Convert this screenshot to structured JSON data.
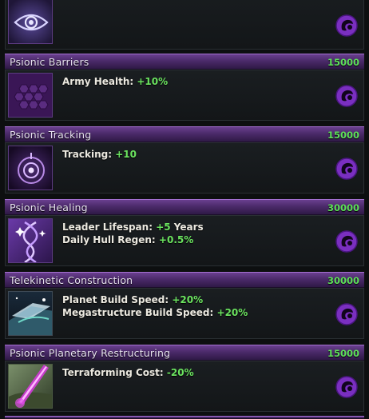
{
  "entries": [
    {
      "name": "",
      "cost": "",
      "icon": "eye-icon",
      "effects": []
    },
    {
      "name": "Psionic Barriers",
      "cost": "15000",
      "icon": "hex-shield-icon",
      "effects": [
        {
          "label": "Army Health:",
          "value": "+10%"
        }
      ]
    },
    {
      "name": "Psionic Tracking",
      "cost": "15000",
      "icon": "tracking-orb-icon",
      "effects": [
        {
          "label": "Tracking:",
          "value": "+10"
        }
      ]
    },
    {
      "name": "Psionic Healing",
      "cost": "30000",
      "icon": "dna-sparkle-icon",
      "effects": [
        {
          "label": "Leader Lifespan:",
          "value": "+5",
          "suffix": "Years"
        },
        {
          "label": "Daily Hull Regen:",
          "value": "+0.5%"
        }
      ]
    },
    {
      "name": "Telekinetic Construction",
      "cost": "30000",
      "icon": "space-construction-icon",
      "effects": [
        {
          "label": "Planet Build Speed:",
          "value": "+20%"
        },
        {
          "label": "Megastructure Build Speed:",
          "value": "+20%"
        }
      ]
    },
    {
      "name": "Psionic Planetary Restructuring",
      "cost": "15000",
      "icon": "terraform-beam-icon",
      "effects": [
        {
          "label": "Terraforming Cost:",
          "value": "-20%"
        }
      ]
    }
  ],
  "colors": {
    "header_purple": "#4b2a6a",
    "cost_green": "#5ee05a",
    "effect_green": "#6be35f",
    "origin_purple": "#7a2fc0"
  },
  "origin_icon": "psionic-origin-icon"
}
